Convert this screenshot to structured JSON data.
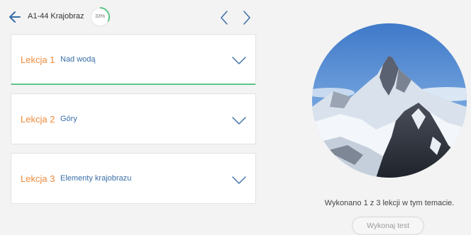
{
  "header": {
    "title": "A1-44 Krajobraz",
    "progress_label": "33%",
    "progress_value": 0.33,
    "back_icon": "arrow-left-icon",
    "prev_icon": "chevron-left-icon",
    "next_icon": "chevron-right-icon"
  },
  "lessons": [
    {
      "number": "Lekcja 1",
      "name": "Nad wodą",
      "active": true
    },
    {
      "number": "Lekcja 2",
      "name": "Góry",
      "active": false
    },
    {
      "number": "Lekcja 3",
      "name": "Elementy krajobrazu",
      "active": false
    }
  ],
  "sidebar": {
    "status_text": "Wykonano 1 z 3 lekcji w tym temacie.",
    "test_button": "Wykonaj test"
  },
  "colors": {
    "accent_orange": "#f08a3a",
    "link_blue": "#3a6ea8",
    "progress_green": "#5cc487",
    "background": "#f3f3f3"
  }
}
